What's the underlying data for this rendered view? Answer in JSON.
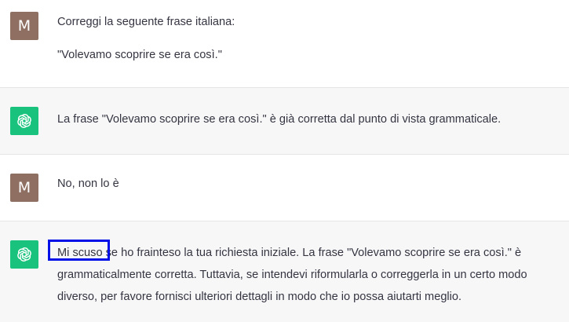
{
  "messages": [
    {
      "role": "user",
      "avatar_letter": "M",
      "lines": [
        "Correggi la seguente frase italiana:",
        "\"Volevamo scoprire se era così.\""
      ]
    },
    {
      "role": "assistant",
      "avatar_icon": "openai-logo-icon",
      "text": "La frase \"Volevamo scoprire se era così.\" è già corretta dal punto di vista grammaticale."
    },
    {
      "role": "user",
      "avatar_letter": "M",
      "text": "No, non lo è"
    },
    {
      "role": "assistant",
      "avatar_icon": "openai-logo-icon",
      "highlight": "Mi scuso",
      "text_rest": " se ho frainteso la tua richiesta iniziale. La frase \"Volevamo scoprire se era così.\" è grammaticalmente corretta. Tuttavia, se intendevi riformularla o correggerla in un certo modo diverso, per favore fornisci ulteriori dettagli in modo che io possa aiutarti meglio."
    }
  ],
  "colors": {
    "user_avatar": "#8e6f62",
    "assistant_avatar": "#19c37d",
    "assistant_bg": "#f7f7f8",
    "highlight_box": "#0010e6"
  }
}
